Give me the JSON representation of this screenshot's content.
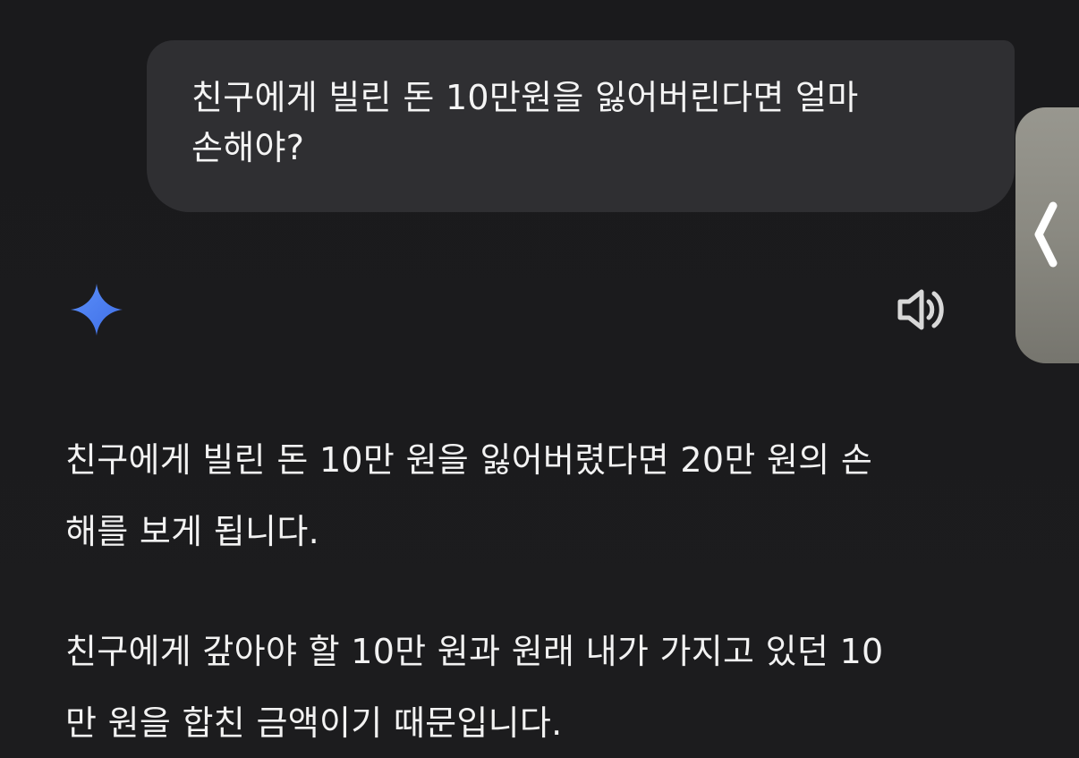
{
  "conversation": {
    "user_message": "친구에게 빌린 돈 10만원을 잃어버린다면 얼마\n손해야?",
    "response": {
      "paragraphs": [
        "친구에게 빌린 돈 10만 원을 잃어버렸다면 20만 원의 손\n해를 보게 됩니다.",
        "친구에게 갚아야 할 10만 원과 원래 내가 가지고 있던 10\n만 원을 합친 금액이기 때문입니다."
      ]
    }
  },
  "icons": {
    "assistant": "gemini-sparkle-icon",
    "read_aloud": "speaker-icon",
    "side_panel": "chevron-left-icon"
  },
  "colors": {
    "background": "#1b1b1d",
    "user_bubble": "#2f2f32",
    "sparkle_blue": "#4a84f5",
    "text": "#f2f2f2"
  }
}
